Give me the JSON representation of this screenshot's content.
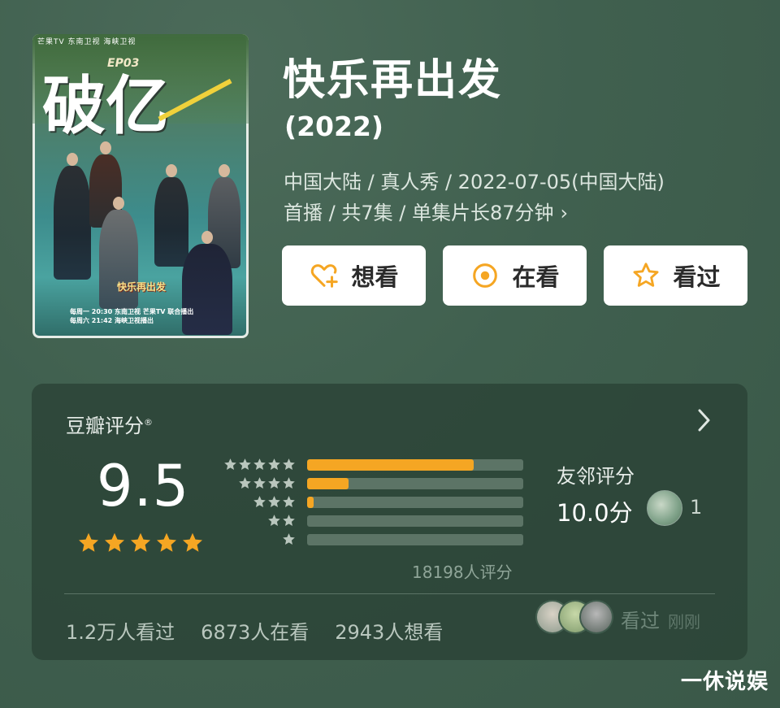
{
  "poster": {
    "top_text": "芒果TV  东南卫视  海峡卫视",
    "badge": "",
    "episode_label": "EP03",
    "big_title": "破亿",
    "logo_text": "快乐再出发",
    "info_line1": "每周一 20:30   东南卫视  芒果TV  联合播出",
    "info_line2": "每周六 21:42   海峡卫视播出"
  },
  "title": "快乐再出发",
  "year": "(2022)",
  "meta": {
    "line1": "中国大陆 / 真人秀 / 2022-07-05(中国大陆)",
    "line2": "首播 / 共7集 / 单集片长87分钟",
    "chevron": "›"
  },
  "actions": [
    {
      "label": "想看",
      "icon": "heart-plus-icon"
    },
    {
      "label": "在看",
      "icon": "target-icon"
    },
    {
      "label": "看过",
      "icon": "star-outline-icon"
    }
  ],
  "rating": {
    "title": "豆瓣评分",
    "reg": "®",
    "score": "9.5",
    "stars": 5,
    "distribution": [
      0.77,
      0.19,
      0.03,
      0.0,
      0.0
    ],
    "count_text": "18198人评分",
    "friend_label": "友邻评分",
    "friend_score": "10.0分",
    "friend_count": "1",
    "stats": [
      "1.2万人看过",
      "6873人在看",
      "2943人想看"
    ],
    "seen_text": "看过",
    "seen_ago": "刚刚"
  },
  "colors": {
    "accent": "#f5a623",
    "card_bg": "#2b4236",
    "page_bg": "#40604f"
  },
  "watermark": "一休说娱"
}
